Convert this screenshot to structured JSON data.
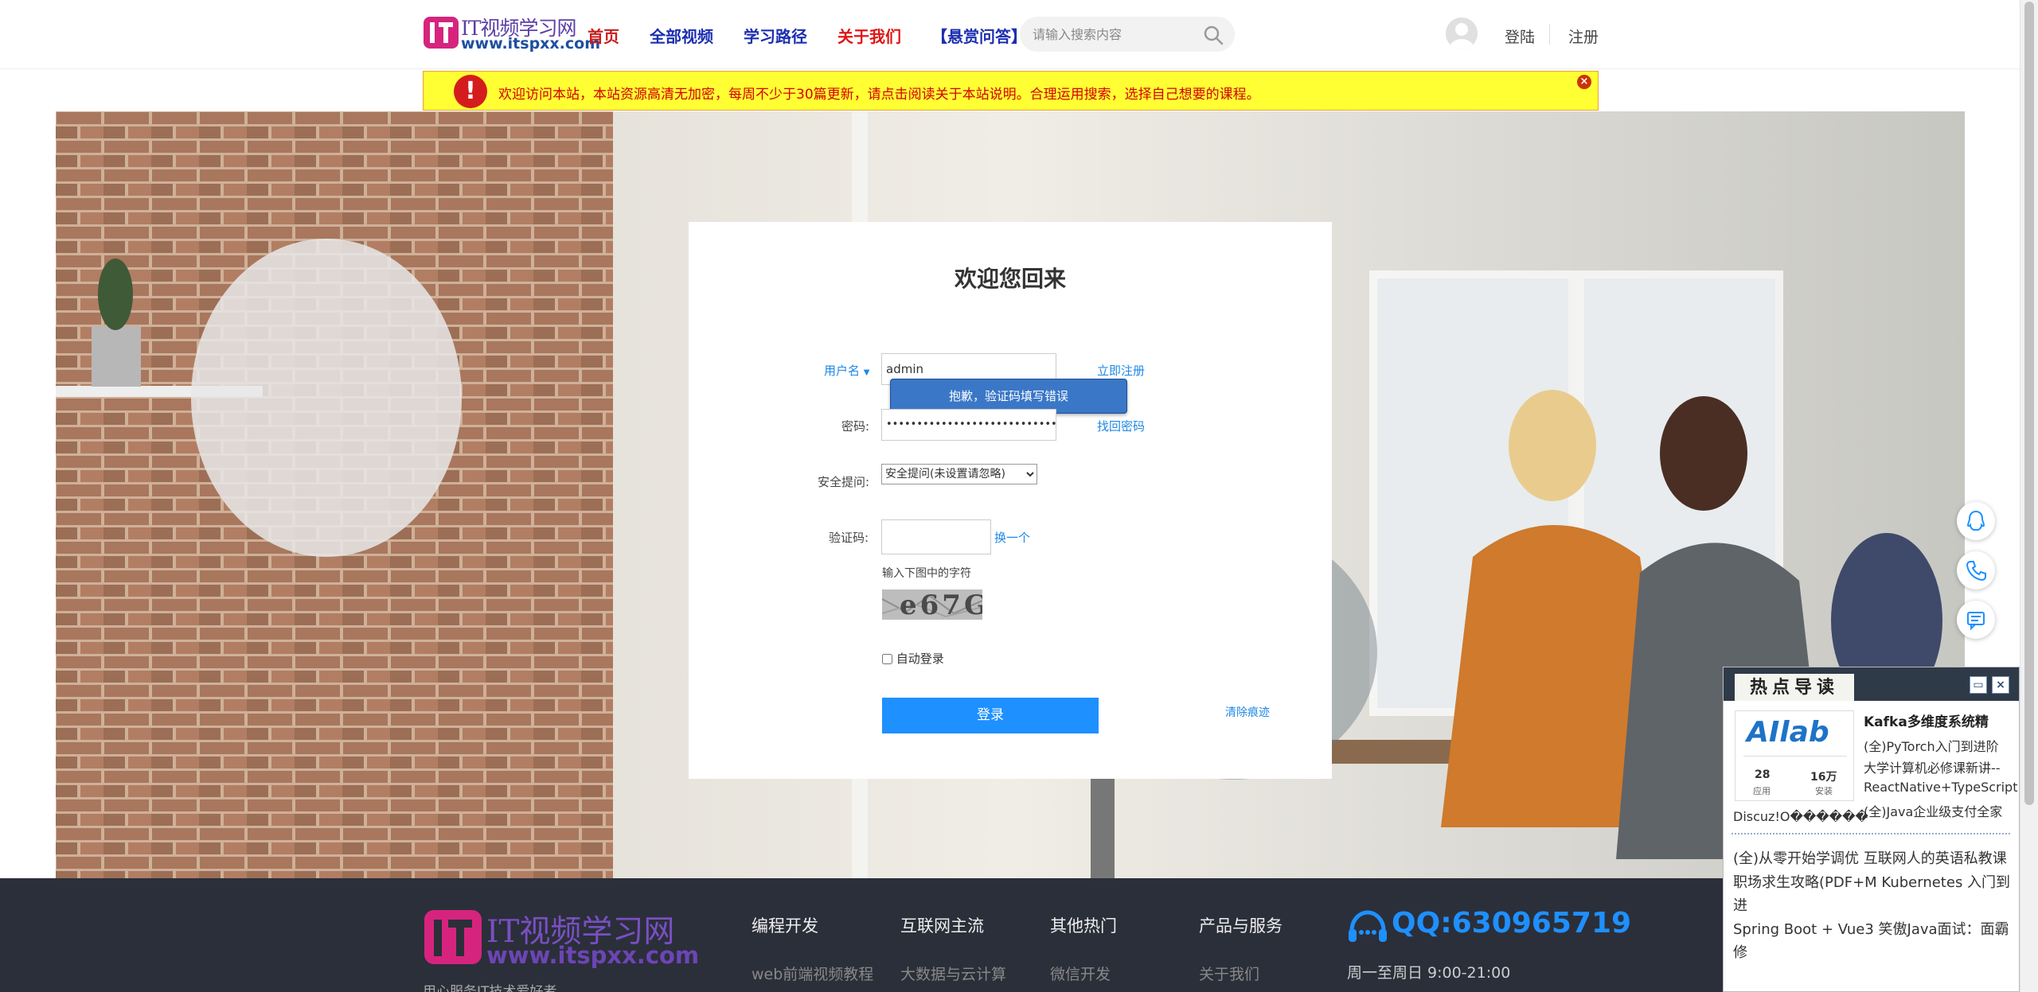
{
  "header": {
    "logo_title": "IT视频学习网",
    "logo_url": "www.itspxx.com",
    "nav": [
      {
        "label": "首页",
        "color": "#c81d1d"
      },
      {
        "label": "全部视频",
        "color": "#1d2fb0"
      },
      {
        "label": "学习路径",
        "color": "#1d2fb0"
      },
      {
        "label": "关于我们",
        "color": "#e01616"
      },
      {
        "label": "【悬赏问答】",
        "color": "#1d2fb0"
      }
    ],
    "search_placeholder": "请输入搜索内容",
    "login_label": "登陆",
    "register_label": "注册"
  },
  "notice": {
    "text": "欢迎访问本站，本站资源高清无加密，每周不少于30篇更新，请点击阅读关于本站说明。合理运用搜索，选择自己想要的课程。"
  },
  "login": {
    "heading": "欢迎您回来",
    "username_label": "用户名",
    "username_value": "admin",
    "register_now": "立即注册",
    "error_tip": "抱歉，验证码填写错误",
    "password_label": "密码:",
    "password_value": "••••••••••••••••••••••••••••••••",
    "forgot_password": "找回密码",
    "security_label": "安全提问:",
    "security_option": "安全提问(未设置请忽略)",
    "captcha_label": "验证码:",
    "captcha_value": "",
    "captcha_refresh": "换一个",
    "captcha_hint": "输入下图中的字符",
    "captcha_text": "e67G",
    "auto_login": "自动登录",
    "submit": "登录",
    "clear_traces": "清除痕迹"
  },
  "footer": {
    "logo_title": "IT视频学习网",
    "logo_url": "www.itspxx.com",
    "slogan": "用心服务IT技术爱好者",
    "columns": [
      {
        "heading": "编程开发",
        "item": "web前端视频教程"
      },
      {
        "heading": "互联网主流",
        "item": "大数据与云计算"
      },
      {
        "heading": "其他热门",
        "item": "微信开发"
      },
      {
        "heading": "产品与服务",
        "item": "关于我们"
      }
    ],
    "qq": "QQ:630965719",
    "hours": "周一至周日 9:00-21:00"
  },
  "popup": {
    "tab_title": "热点导读",
    "ad_brand": "AIlab",
    "ad_stat1_num": "28",
    "ad_stat1_lbl": "应用",
    "ad_stat2_num": "16万",
    "ad_stat2_lbl": "安装",
    "title": "Kafka多维度系统精",
    "items_right": [
      "(全)PyTorch入门到进阶",
      "大学计算机必修课新讲--",
      "ReactNative+TypeScript",
      "(全)Java企业级支付全家"
    ],
    "item_garbled": "Discuz!O������",
    "lines": [
      "(全)从零开始学调优  互联网人的英语私教课",
      "职场求生攻略(PDF+M  Kubernetes 入门到",
      "进",
      "Spring Boot + Vue3  笑傲Java面试：面霸",
      "修"
    ]
  }
}
